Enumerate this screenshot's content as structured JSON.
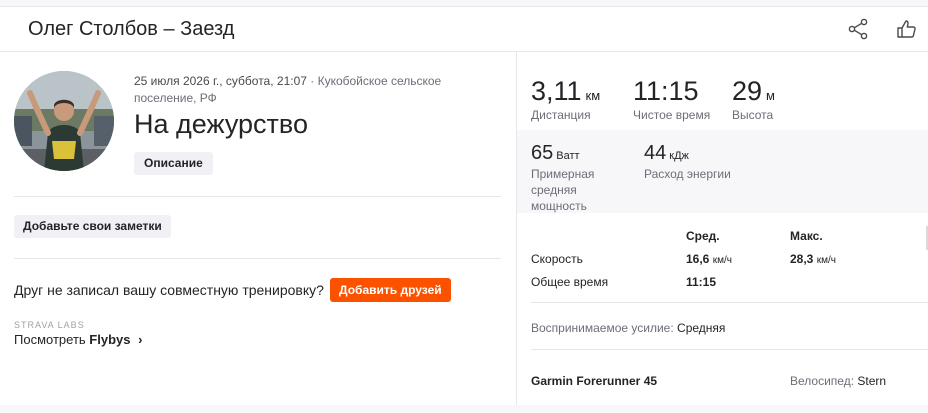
{
  "header": {
    "title": "Олег Столбов – Заезд",
    "share_icon": "share-icon",
    "kudos_icon": "thumbs-up-icon"
  },
  "activity": {
    "date": "25 июля 2026 г., суббота, 21:07",
    "location": " · Кукобойское сельское поселение, РФ",
    "name": "На дежурство",
    "description_button": "Описание"
  },
  "notes": {
    "add_notes_button": "Добавьте свои заметки"
  },
  "friends": {
    "question": "Друг не записал вашу совместную тренировку?",
    "add_button": "Добавить друзей"
  },
  "labs": {
    "label": "STRAVA LABS",
    "flybys_prefix": "Посмотреть ",
    "flybys_bold": "Flybys",
    "chevron": "›"
  },
  "stats": {
    "distance": {
      "value": "3,11",
      "unit": "км",
      "label": "Дистанция"
    },
    "moving_time": {
      "value": "11:15",
      "label": "Чистое время"
    },
    "elevation": {
      "value": "29",
      "unit": "м",
      "label": "Высота"
    },
    "power": {
      "value": "65",
      "unit": "Ватт",
      "label": "Примерная средняя мощность"
    },
    "energy": {
      "value": "44",
      "unit": "кДж",
      "label": "Расход энергии"
    }
  },
  "table": {
    "headers": {
      "avg": "Сред.",
      "max": "Макс."
    },
    "rows": [
      {
        "label": "Скорость",
        "avg": "16,6",
        "avg_unit": "км/ч",
        "max": "28,3",
        "max_unit": "км/ч"
      },
      {
        "label": "Общее время",
        "avg": "11:15"
      }
    ]
  },
  "effort": {
    "label": "Воспринимаемое усилие: ",
    "value": "Средняя"
  },
  "gear": {
    "device": "Garmin Forerunner 45",
    "bike_label": "Велосипед: ",
    "bike_value": "Stern"
  },
  "colors": {
    "accent": "#fc5200",
    "gray_bg": "#f7f7fa",
    "divider": "#e6e6eb"
  }
}
